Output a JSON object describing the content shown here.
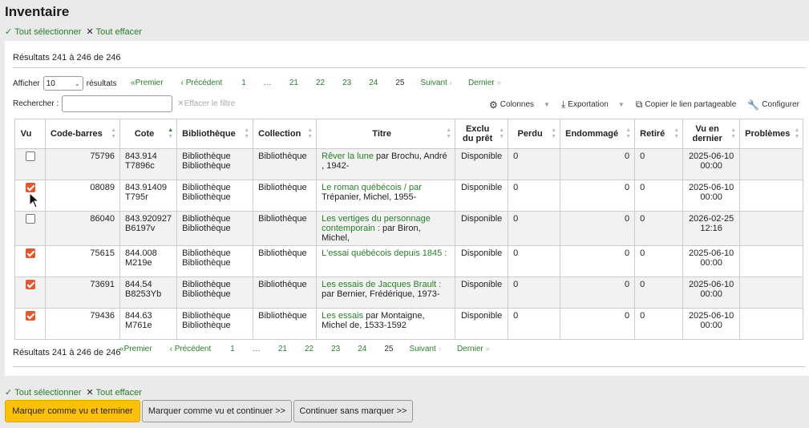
{
  "page": {
    "title": "Inventaire"
  },
  "select_links": {
    "select_all": "Tout sélectionner",
    "clear_all": "Tout effacer"
  },
  "results_info": "Résultats 241 à 246 de 246",
  "length": {
    "label_before": "Afficher",
    "value": "10",
    "label_after": "résultats"
  },
  "pager": {
    "first": "Premier",
    "prev": "Précédent",
    "pages": [
      "1",
      "…",
      "21",
      "22",
      "23",
      "24",
      "25"
    ],
    "current": "25",
    "next": "Suivant",
    "last": "Dernier"
  },
  "search": {
    "label": "Rechercher :",
    "value": "",
    "clear": "Effacer le filtre"
  },
  "tools": {
    "columns": "Colonnes",
    "export": "Exportation",
    "copy_link": "Copier le lien partageable",
    "configure": "Configurer"
  },
  "table": {
    "headers": [
      "Vu",
      "Code-barres",
      "Cote",
      "Bibliothèque",
      "Collection",
      "Titre",
      "Exclu du prêt",
      "Perdu",
      "Endommagé",
      "Retiré",
      "Vu en dernier",
      "Problèmes"
    ],
    "rows": [
      {
        "checked": false,
        "barcode": "75796",
        "callnumber": "843.914 T7896c",
        "library": "Bibliothèque Bibliothèque",
        "collection": "Bibliothèque",
        "title_link": "Rêver la lune",
        "title_rest": " par Brochu, André , 1942-",
        "notforloan": "Disponible",
        "lost": "0",
        "damaged": "0",
        "withdrawn": "0",
        "lastseen": "2025-06-10 00:00",
        "problems": ""
      },
      {
        "checked": true,
        "barcode": "08089",
        "callnumber": "843.91409 T795r",
        "library": "Bibliothèque Bibliothèque",
        "collection": "Bibliothèque",
        "title_link": "Le roman québécois / par",
        "title_rest": " Trépanier, Michel, 1955-",
        "notforloan": "Disponible",
        "lost": "0",
        "damaged": "0",
        "withdrawn": "0",
        "lastseen": "2025-06-10 00:00",
        "problems": ""
      },
      {
        "checked": false,
        "barcode": "86040",
        "callnumber": "843.920927 B6197v",
        "library": "Bibliothèque Bibliothèque",
        "collection": "Bibliothèque",
        "title_link": "Les vertiges du personnage contemporain :",
        "title_rest": " par Biron, Michel,",
        "notforloan": "Disponible",
        "lost": "0",
        "damaged": "0",
        "withdrawn": "0",
        "lastseen": "2026-02-25 12:16",
        "problems": ""
      },
      {
        "checked": true,
        "barcode": "75615",
        "callnumber": "844.008 M219e",
        "library": "Bibliothèque Bibliothèque",
        "collection": "Bibliothèque",
        "title_link": "L'essai québécois depuis 1845 :",
        "title_rest": "",
        "notforloan": "Disponible",
        "lost": "0",
        "damaged": "0",
        "withdrawn": "0",
        "lastseen": "2025-06-10 00:00",
        "problems": ""
      },
      {
        "checked": true,
        "barcode": "73691",
        "callnumber": "844.54 B8253Yb",
        "library": "Bibliothèque Bibliothèque",
        "collection": "Bibliothèque",
        "title_link": "Les essais de Jacques Brault :",
        "title_rest": " par Bernier, Frédérique, 1973-",
        "notforloan": "Disponible",
        "lost": "0",
        "damaged": "0",
        "withdrawn": "0",
        "lastseen": "2025-06-10 00:00",
        "problems": ""
      },
      {
        "checked": true,
        "barcode": "79436",
        "callnumber": "844.63 M761e",
        "library": "Bibliothèque Bibliothèque",
        "collection": "Bibliothèque",
        "title_link": "Les essais",
        "title_rest": " par Montaigne, Michel de, 1533-1592",
        "notforloan": "Disponible",
        "lost": "0",
        "damaged": "0",
        "withdrawn": "0",
        "lastseen": "2025-06-10 00:00",
        "problems": ""
      }
    ]
  },
  "buttons": {
    "finish": "Marquer comme vu et terminer",
    "continue": "Marquer comme vu et continuer >>",
    "skip": "Continuer sans marquer >>"
  },
  "colors": {
    "accent": "#2a7d2a",
    "checkbox": "#e2572b",
    "primary_button": "#ffc107"
  }
}
